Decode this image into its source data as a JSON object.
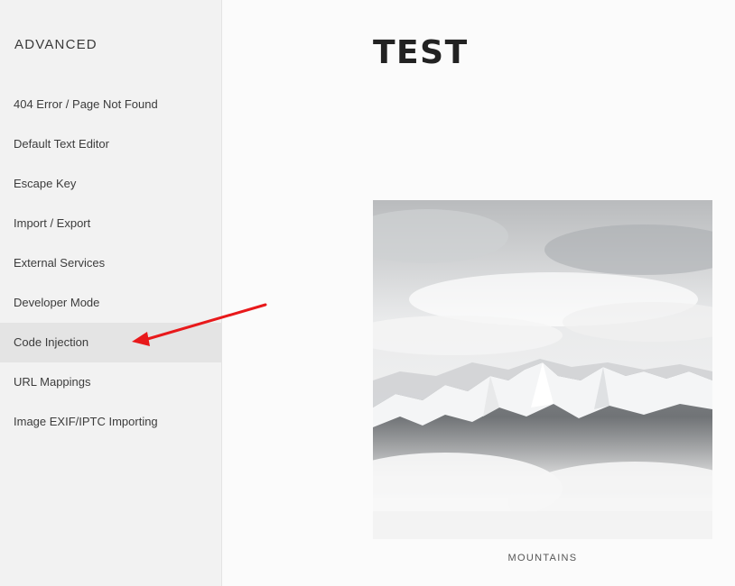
{
  "sidebar": {
    "title": "ADVANCED",
    "items": [
      {
        "label": "404 Error / Page Not Found"
      },
      {
        "label": "Default Text Editor"
      },
      {
        "label": "Escape Key"
      },
      {
        "label": "Import / Export"
      },
      {
        "label": "External Services"
      },
      {
        "label": "Developer Mode"
      },
      {
        "label": "Code Injection",
        "active": true
      },
      {
        "label": "URL Mappings"
      },
      {
        "label": "Image EXIF/IPTC Importing"
      }
    ]
  },
  "preview": {
    "title": "TEST",
    "image_alt": "mountains-photo",
    "caption": "MOUNTAINS"
  },
  "annotation": {
    "arrow_color": "#e8191b",
    "points_to": "Code Injection"
  },
  "colors": {
    "sidebar_bg": "#f2f2f2",
    "active_item_bg": "#e4e4e4",
    "main_bg": "#fbfbfb"
  }
}
